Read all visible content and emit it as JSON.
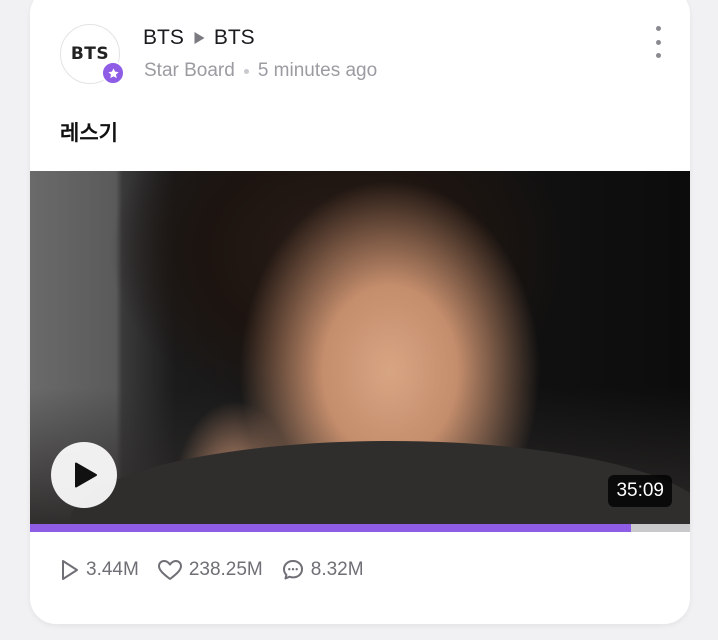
{
  "post": {
    "avatar_text": "BTS",
    "author": "BTS",
    "target": "BTS",
    "board": "Star Board",
    "time": "5 minutes ago",
    "text": "레스기"
  },
  "video": {
    "duration": "35:09",
    "progress_fraction": 0.91
  },
  "stats": {
    "plays": "3.44M",
    "likes": "238.25M",
    "comments": "8.32M"
  },
  "colors": {
    "accent": "#8f5ce6"
  },
  "icons": {
    "badge": "star-icon",
    "separator": "arrow-right-icon",
    "menu": "more-vertical-icon",
    "play": "play-icon",
    "plays": "play-outline-icon",
    "likes": "heart-outline-icon",
    "comments": "comment-outline-icon"
  }
}
